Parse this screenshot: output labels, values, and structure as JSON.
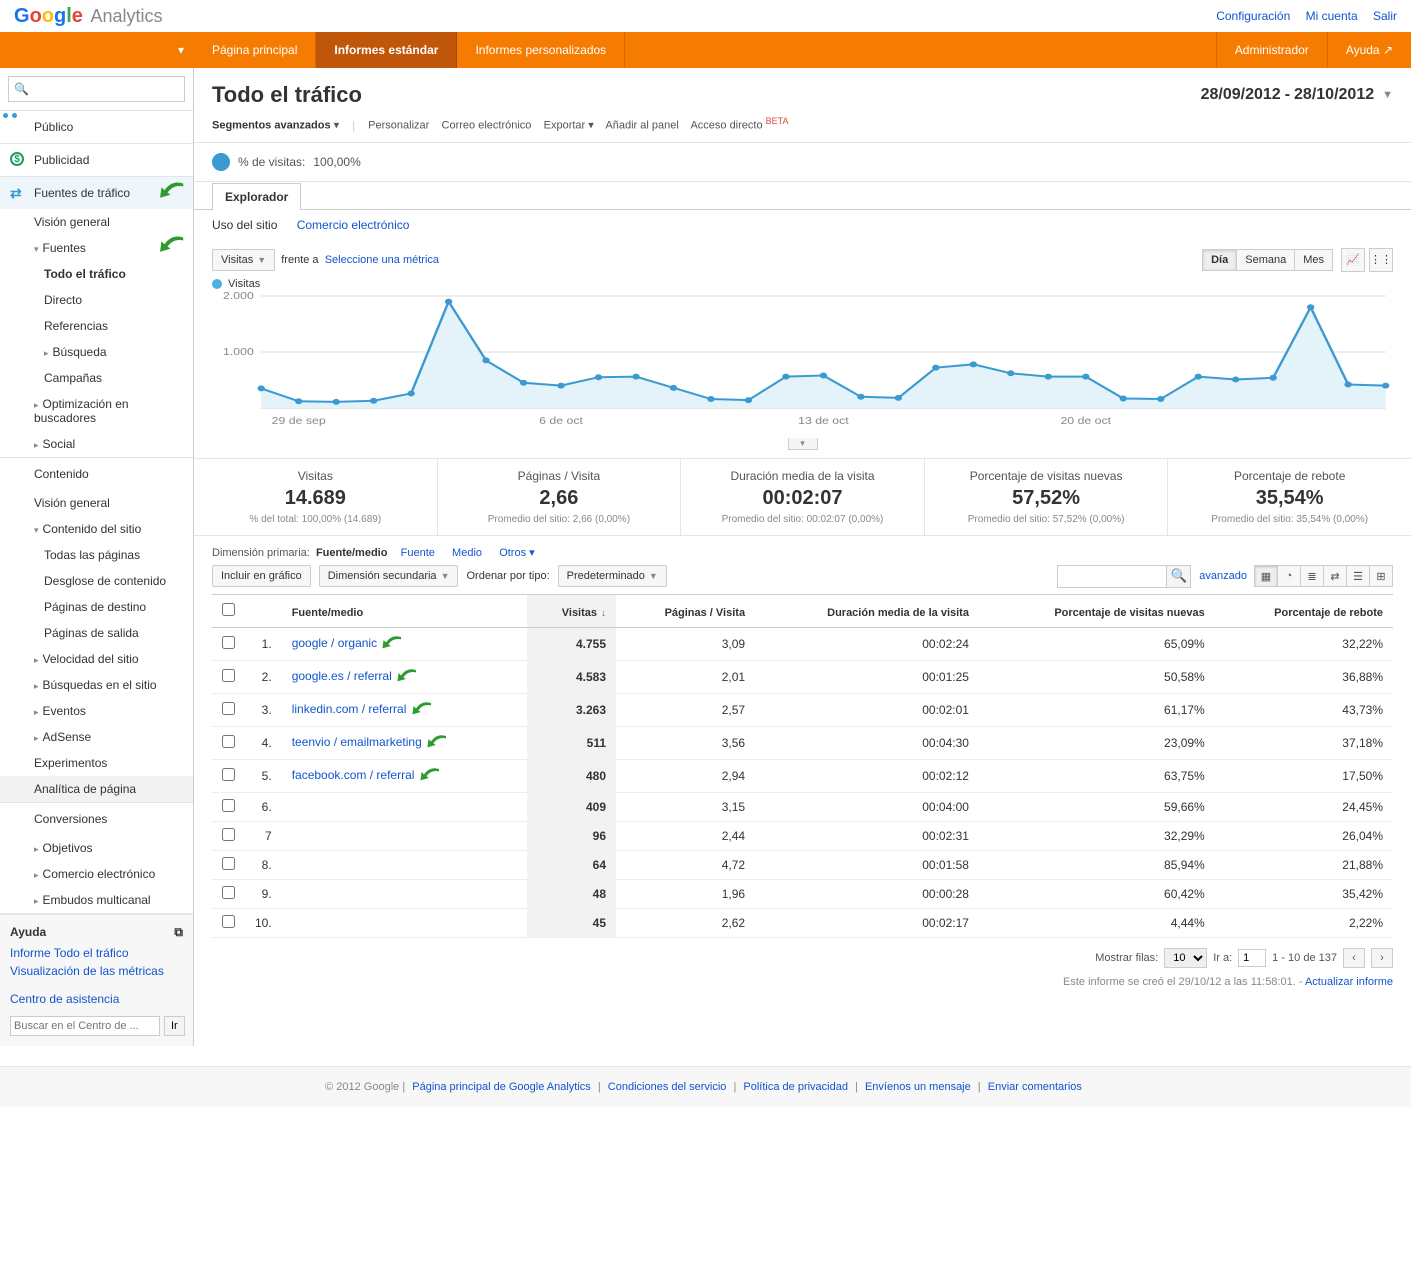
{
  "brand": {
    "analytics": "Analytics"
  },
  "topbar": {
    "config": "Configuración",
    "account": "Mi cuenta",
    "logout": "Salir"
  },
  "nav": {
    "home": "Página principal",
    "standard": "Informes estándar",
    "custom": "Informes personalizados",
    "admin": "Administrador",
    "help": "Ayuda"
  },
  "sidebar": {
    "publico": "Público",
    "publicidad": "Publicidad",
    "fuentes": "Fuentes de tráfico",
    "vision": "Visión general",
    "fuentes_sub": "Fuentes",
    "todo": "Todo el tráfico",
    "directo": "Directo",
    "referencias": "Referencias",
    "busqueda": "Búsqueda",
    "campanas": "Campañas",
    "seo": "Optimización en buscadores",
    "social": "Social",
    "contenido": "Contenido",
    "cs_vision": "Visión general",
    "cs_sitio": "Contenido del sitio",
    "cs_todas": "Todas las páginas",
    "cs_desglose": "Desglose de contenido",
    "cs_destino": "Páginas de destino",
    "cs_salida": "Páginas de salida",
    "velocidad": "Velocidad del sitio",
    "busquedas": "Búsquedas en el sitio",
    "eventos": "Eventos",
    "adsense": "AdSense",
    "experimentos": "Experimentos",
    "analitica": "Analítica de página",
    "conversiones": "Conversiones",
    "objetivos": "Objetivos",
    "ecom": "Comercio electrónico",
    "embudos": "Embudos multicanal"
  },
  "help": {
    "title": "Ayuda",
    "link1": "Informe Todo el tráfico",
    "link2": "Visualización de las métricas",
    "center": "Centro de asistencia",
    "placeholder": "Buscar en el Centro de ...",
    "go": "Ir"
  },
  "page": {
    "title": "Todo el tráfico",
    "date_from": "28/09/2012",
    "date_to": "28/10/2012"
  },
  "actions": {
    "segmentos": "Segmentos avanzados",
    "personalizar": "Personalizar",
    "correo": "Correo electrónico",
    "exportar": "Exportar",
    "panel": "Añadir al panel",
    "acceso": "Acceso directo",
    "beta": "BETA"
  },
  "pct": {
    "label": "% de visitas:",
    "value": "100,00%"
  },
  "tabs": {
    "explorador": "Explorador"
  },
  "subtabs": {
    "uso": "Uso del sitio",
    "ecom": "Comercio electrónico"
  },
  "chart_controls": {
    "visitas": "Visitas",
    "frente": "frente a",
    "select_metric": "Seleccione una métrica",
    "dia": "Día",
    "semana": "Semana",
    "mes": "Mes"
  },
  "legend": {
    "visitas": "Visitas"
  },
  "chart_data": {
    "type": "line",
    "ylabel": "",
    "ylim": [
      0,
      2000
    ],
    "yticks": [
      "1.000",
      "2.000"
    ],
    "x_labels": [
      "29 de sep",
      "6 de oct",
      "13 de oct",
      "20 de oct"
    ],
    "series": [
      {
        "name": "Visitas",
        "values": [
          350,
          120,
          110,
          130,
          260,
          1900,
          850,
          450,
          400,
          550,
          560,
          360,
          160,
          140,
          560,
          580,
          200,
          180,
          720,
          780,
          620,
          560,
          560,
          170,
          160,
          560,
          510,
          540,
          1800,
          420,
          400
        ]
      }
    ]
  },
  "metrics": [
    {
      "label": "Visitas",
      "value": "14.689",
      "sub": "% del total: 100,00% (14.689)"
    },
    {
      "label": "Páginas / Visita",
      "value": "2,66",
      "sub": "Promedio del sitio: 2,66 (0,00%)"
    },
    {
      "label": "Duración media de la visita",
      "value": "00:02:07",
      "sub": "Promedio del sitio: 00:02:07 (0,00%)"
    },
    {
      "label": "Porcentaje de visitas nuevas",
      "value": "57,52%",
      "sub": "Promedio del sitio: 57,52% (0,00%)"
    },
    {
      "label": "Porcentaje de rebote",
      "value": "35,54%",
      "sub": "Promedio del sitio: 35,54% (0,00%)"
    }
  ],
  "dim": {
    "label": "Dimensión primaria:",
    "fuente_medio": "Fuente/medio",
    "fuente": "Fuente",
    "medio": "Medio",
    "otros": "Otros"
  },
  "tblctrl": {
    "incluir": "Incluir en gráfico",
    "secundaria": "Dimensión secundaria",
    "ordenar": "Ordenar por tipo:",
    "predeterminado": "Predeterminado",
    "avanzado": "avanzado"
  },
  "columns": {
    "fuente": "Fuente/medio",
    "visitas": "Visitas",
    "pages": "Páginas / Visita",
    "dur": "Duración media de la visita",
    "nuevas": "Porcentaje de visitas nuevas",
    "rebote": "Porcentaje de rebote"
  },
  "rows": [
    {
      "n": "1.",
      "src": "google / organic",
      "arrow": true,
      "visits": "4.755",
      "pages": "3,09",
      "dur": "00:02:24",
      "nuevas": "65,09%",
      "rebote": "32,22%"
    },
    {
      "n": "2.",
      "src": "google.es / referral",
      "arrow": true,
      "visits": "4.583",
      "pages": "2,01",
      "dur": "00:01:25",
      "nuevas": "50,58%",
      "rebote": "36,88%"
    },
    {
      "n": "3.",
      "src": "linkedin.com / referral",
      "arrow": true,
      "visits": "3.263",
      "pages": "2,57",
      "dur": "00:02:01",
      "nuevas": "61,17%",
      "rebote": "43,73%"
    },
    {
      "n": "4.",
      "src": "teenvio / emailmarketing",
      "arrow": true,
      "visits": "511",
      "pages": "3,56",
      "dur": "00:04:30",
      "nuevas": "23,09%",
      "rebote": "37,18%"
    },
    {
      "n": "5.",
      "src": "facebook.com / referral",
      "arrow": true,
      "visits": "480",
      "pages": "2,94",
      "dur": "00:02:12",
      "nuevas": "63,75%",
      "rebote": "17,50%"
    },
    {
      "n": "6.",
      "src": "",
      "arrow": false,
      "visits": "409",
      "pages": "3,15",
      "dur": "00:04:00",
      "nuevas": "59,66%",
      "rebote": "24,45%"
    },
    {
      "n": "7",
      "src": "",
      "arrow": false,
      "visits": "96",
      "pages": "2,44",
      "dur": "00:02:31",
      "nuevas": "32,29%",
      "rebote": "26,04%"
    },
    {
      "n": "8.",
      "src": "",
      "arrow": false,
      "visits": "64",
      "pages": "4,72",
      "dur": "00:01:58",
      "nuevas": "85,94%",
      "rebote": "21,88%"
    },
    {
      "n": "9.",
      "src": "",
      "arrow": false,
      "visits": "48",
      "pages": "1,96",
      "dur": "00:00:28",
      "nuevas": "60,42%",
      "rebote": "35,42%"
    },
    {
      "n": "10.",
      "src": "",
      "arrow": false,
      "visits": "45",
      "pages": "2,62",
      "dur": "00:02:17",
      "nuevas": "4,44%",
      "rebote": "2,22%"
    }
  ],
  "pager": {
    "mostrar": "Mostrar filas:",
    "rows": "10",
    "ira": "Ir a:",
    "page": "1",
    "range": "1 - 10 de 137"
  },
  "report_time": {
    "text": "Este informe se creó el 29/10/12 a las 11:58:01. -",
    "refresh": "Actualizar informe"
  },
  "footer": {
    "copy": "© 2012 Google",
    "l1": "Página principal de Google Analytics",
    "l2": "Condiciones del servicio",
    "l3": "Política de privacidad",
    "l4": "Envíenos un mensaje",
    "l5": "Enviar comentarios"
  }
}
